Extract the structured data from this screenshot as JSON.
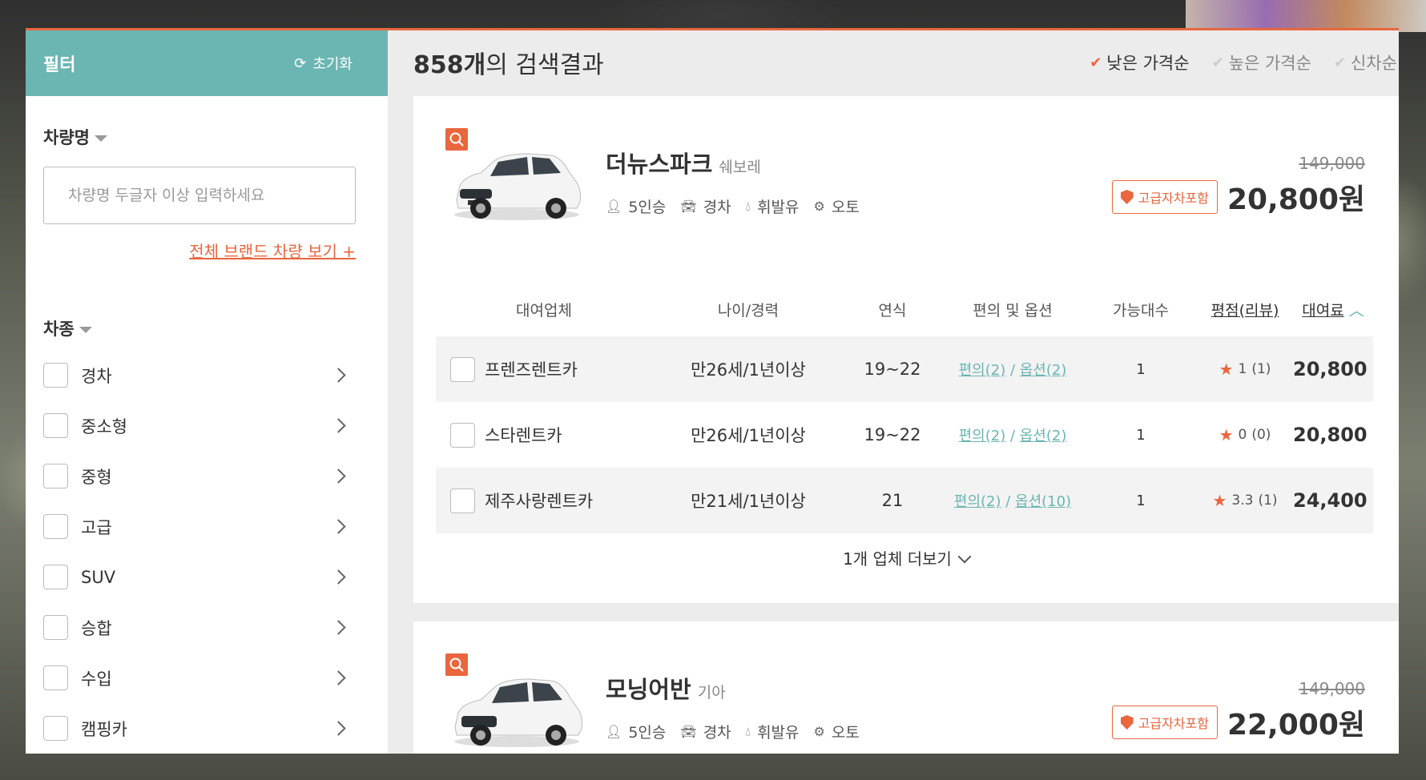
{
  "sidebar": {
    "title": "필터",
    "reset_label": "초기화",
    "name_section_title": "차량명",
    "name_placeholder": "차량명 두글자 이상 입력하세요",
    "brand_link": "전체 브랜드 차량 보기 +",
    "type_section_title": "차종",
    "types": [
      {
        "label": "경차"
      },
      {
        "label": "중소형"
      },
      {
        "label": "중형"
      },
      {
        "label": "고급"
      },
      {
        "label": "SUV"
      },
      {
        "label": "승합"
      },
      {
        "label": "수입"
      },
      {
        "label": "캠핑카"
      }
    ]
  },
  "results": {
    "count_number": "858개",
    "count_suffix": "의 검색결과",
    "sort_options": [
      {
        "label": "낮은 가격순",
        "active": true
      },
      {
        "label": "높은 가격순",
        "active": false
      },
      {
        "label": "신차순",
        "active": false
      }
    ]
  },
  "table_headers": {
    "vendor": "대여업체",
    "age": "나이/경력",
    "year": "연식",
    "options": "편의 및 옵션",
    "available": "가능대수",
    "rating": "평점(리뷰)",
    "fee": "대여료"
  },
  "cars": [
    {
      "name": "더뉴스파크",
      "maker": "쉐보레",
      "specs": {
        "seats": "5인승",
        "class": "경차",
        "fuel": "휘발유",
        "transmission": "오토"
      },
      "original_price": "149,000",
      "badge": "고급자차포함",
      "price": "20,800원",
      "rows": [
        {
          "vendor": "프렌즈렌트카",
          "age": "만26세/1년이상",
          "year": "19~22",
          "conv": "편의(2)",
          "opt": "옵션(2)",
          "available": "1",
          "rating": "1",
          "reviews": "(1)",
          "fee": "20,800"
        },
        {
          "vendor": "스타렌트카",
          "age": "만26세/1년이상",
          "year": "19~22",
          "conv": "편의(2)",
          "opt": "옵션(2)",
          "available": "1",
          "rating": "0",
          "reviews": "(0)",
          "fee": "20,800"
        },
        {
          "vendor": "제주사랑렌트카",
          "age": "만21세/1년이상",
          "year": "21",
          "conv": "편의(2)",
          "opt": "옵션(10)",
          "available": "1",
          "rating": "3.3",
          "reviews": "(1)",
          "fee": "24,400"
        }
      ],
      "more_label": "1개 업체 더보기"
    },
    {
      "name": "모닝어반",
      "maker": "기아",
      "specs": {
        "seats": "5인승",
        "class": "경차",
        "fuel": "휘발유",
        "transmission": "오토"
      },
      "original_price": "149,000",
      "badge": "고급자차포함",
      "price": "22,000원"
    }
  ],
  "colors": {
    "accent": "#e9663e",
    "teal": "#6bb6b2"
  },
  "icons": {
    "reset": "refresh-icon",
    "zoom": "search-icon",
    "seats": "person-icon",
    "class": "car-icon",
    "fuel": "drop-icon",
    "transmission": "gearshift-icon",
    "badge": "shield-icon",
    "star": "star-icon"
  }
}
